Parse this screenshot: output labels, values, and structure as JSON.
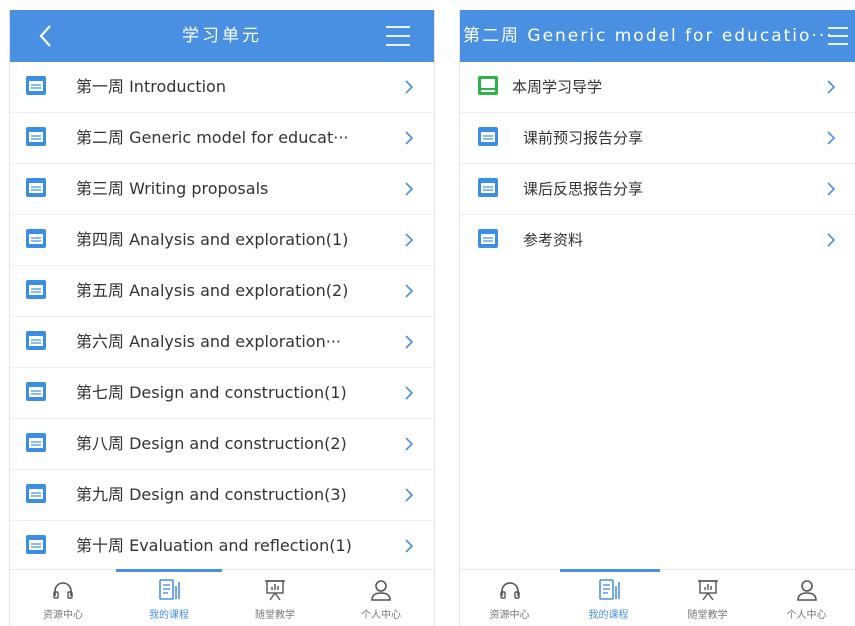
{
  "left_screen": {
    "header": {
      "title": "学习单元"
    },
    "units": [
      {
        "label": "第一周 Introduction"
      },
      {
        "label": "第二周 Generic model for educat···"
      },
      {
        "label": "第三周 Writing proposals"
      },
      {
        "label": "第四周 Analysis and exploration(1)"
      },
      {
        "label": "第五周 Analysis and exploration(2)"
      },
      {
        "label": "第六周 Analysis and exploration···"
      },
      {
        "label": "第七周 Design and construction(1)"
      },
      {
        "label": "第八周 Design and construction(2)"
      },
      {
        "label": "第九周 Design and construction(3)"
      },
      {
        "label": "第十周 Evaluation and reflection(1)"
      }
    ]
  },
  "right_screen": {
    "header": {
      "title": "第二周 Generic model for educatio···"
    },
    "items": [
      {
        "label": "本周学习导学",
        "icon": "guide-icon"
      },
      {
        "label": "课前预习报告分享",
        "icon": "folder-icon"
      },
      {
        "label": "课后反思报告分享",
        "icon": "folder-icon"
      },
      {
        "label": "参考资料",
        "icon": "folder-icon"
      }
    ]
  },
  "tabbar": {
    "tabs": [
      {
        "label": "资源中心",
        "icon": "headphones-icon"
      },
      {
        "label": "我的课程",
        "icon": "course-icon"
      },
      {
        "label": "随堂教学",
        "icon": "presentation-icon"
      },
      {
        "label": "个人中心",
        "icon": "user-icon"
      }
    ],
    "active_index": 1
  },
  "colors": {
    "accent": "#4a90e2",
    "folder": "#3a8ee6",
    "guide": "#2db34a",
    "text": "#333333",
    "chevron": "#4a90e2"
  }
}
